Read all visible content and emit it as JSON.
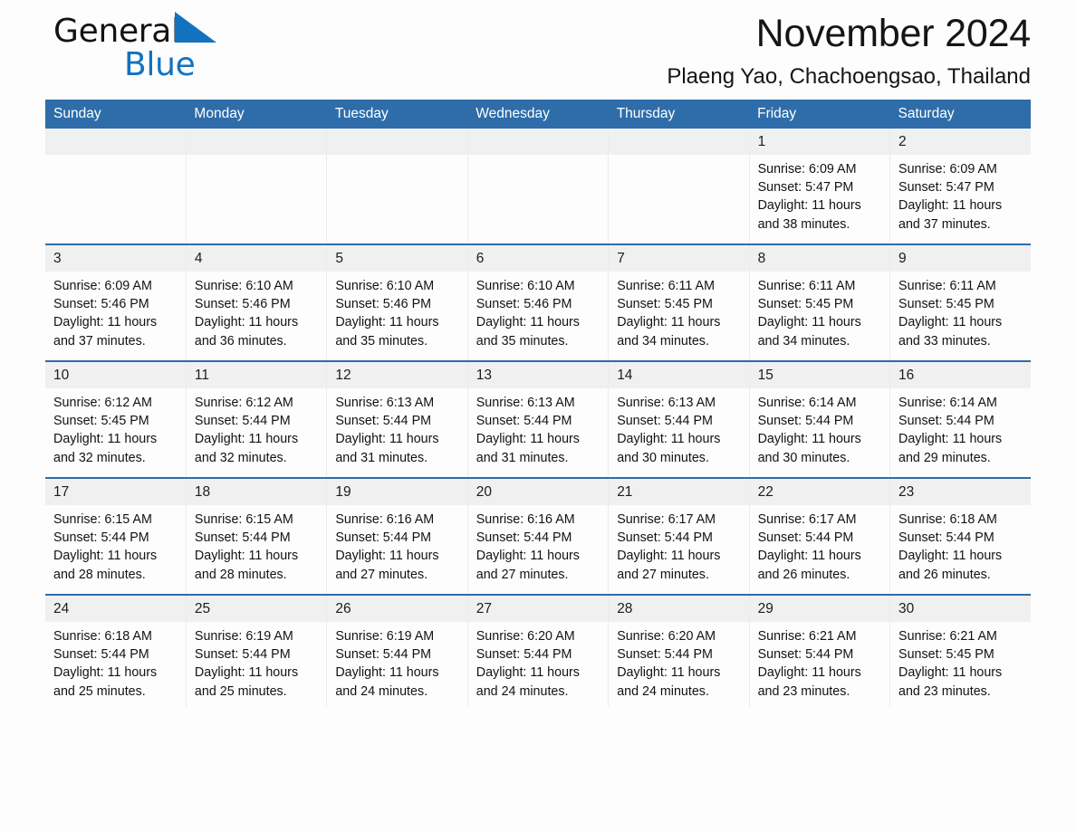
{
  "brand": {
    "name_part1": "General",
    "name_part2": "Blue",
    "logo_icon": "triangle-flag-icon",
    "accent_color": "#1272c0"
  },
  "header": {
    "month_title": "November 2024",
    "location": "Plaeng Yao, Chachoengsao, Thailand"
  },
  "theme": {
    "header_blue": "#2e6da9",
    "daynum_band": "#f0f0f0",
    "page_background": "#fdfdfd"
  },
  "calendar": {
    "weekday_headers": [
      "Sunday",
      "Monday",
      "Tuesday",
      "Wednesday",
      "Thursday",
      "Friday",
      "Saturday"
    ],
    "weeks": [
      [
        {
          "day": "",
          "sunrise": "",
          "sunset": "",
          "daylight_line1": "",
          "daylight_line2": ""
        },
        {
          "day": "",
          "sunrise": "",
          "sunset": "",
          "daylight_line1": "",
          "daylight_line2": ""
        },
        {
          "day": "",
          "sunrise": "",
          "sunset": "",
          "daylight_line1": "",
          "daylight_line2": ""
        },
        {
          "day": "",
          "sunrise": "",
          "sunset": "",
          "daylight_line1": "",
          "daylight_line2": ""
        },
        {
          "day": "",
          "sunrise": "",
          "sunset": "",
          "daylight_line1": "",
          "daylight_line2": ""
        },
        {
          "day": "1",
          "sunrise": "Sunrise: 6:09 AM",
          "sunset": "Sunset: 5:47 PM",
          "daylight_line1": "Daylight: 11 hours",
          "daylight_line2": "and 38 minutes."
        },
        {
          "day": "2",
          "sunrise": "Sunrise: 6:09 AM",
          "sunset": "Sunset: 5:47 PM",
          "daylight_line1": "Daylight: 11 hours",
          "daylight_line2": "and 37 minutes."
        }
      ],
      [
        {
          "day": "3",
          "sunrise": "Sunrise: 6:09 AM",
          "sunset": "Sunset: 5:46 PM",
          "daylight_line1": "Daylight: 11 hours",
          "daylight_line2": "and 37 minutes."
        },
        {
          "day": "4",
          "sunrise": "Sunrise: 6:10 AM",
          "sunset": "Sunset: 5:46 PM",
          "daylight_line1": "Daylight: 11 hours",
          "daylight_line2": "and 36 minutes."
        },
        {
          "day": "5",
          "sunrise": "Sunrise: 6:10 AM",
          "sunset": "Sunset: 5:46 PM",
          "daylight_line1": "Daylight: 11 hours",
          "daylight_line2": "and 35 minutes."
        },
        {
          "day": "6",
          "sunrise": "Sunrise: 6:10 AM",
          "sunset": "Sunset: 5:46 PM",
          "daylight_line1": "Daylight: 11 hours",
          "daylight_line2": "and 35 minutes."
        },
        {
          "day": "7",
          "sunrise": "Sunrise: 6:11 AM",
          "sunset": "Sunset: 5:45 PM",
          "daylight_line1": "Daylight: 11 hours",
          "daylight_line2": "and 34 minutes."
        },
        {
          "day": "8",
          "sunrise": "Sunrise: 6:11 AM",
          "sunset": "Sunset: 5:45 PM",
          "daylight_line1": "Daylight: 11 hours",
          "daylight_line2": "and 34 minutes."
        },
        {
          "day": "9",
          "sunrise": "Sunrise: 6:11 AM",
          "sunset": "Sunset: 5:45 PM",
          "daylight_line1": "Daylight: 11 hours",
          "daylight_line2": "and 33 minutes."
        }
      ],
      [
        {
          "day": "10",
          "sunrise": "Sunrise: 6:12 AM",
          "sunset": "Sunset: 5:45 PM",
          "daylight_line1": "Daylight: 11 hours",
          "daylight_line2": "and 32 minutes."
        },
        {
          "day": "11",
          "sunrise": "Sunrise: 6:12 AM",
          "sunset": "Sunset: 5:44 PM",
          "daylight_line1": "Daylight: 11 hours",
          "daylight_line2": "and 32 minutes."
        },
        {
          "day": "12",
          "sunrise": "Sunrise: 6:13 AM",
          "sunset": "Sunset: 5:44 PM",
          "daylight_line1": "Daylight: 11 hours",
          "daylight_line2": "and 31 minutes."
        },
        {
          "day": "13",
          "sunrise": "Sunrise: 6:13 AM",
          "sunset": "Sunset: 5:44 PM",
          "daylight_line1": "Daylight: 11 hours",
          "daylight_line2": "and 31 minutes."
        },
        {
          "day": "14",
          "sunrise": "Sunrise: 6:13 AM",
          "sunset": "Sunset: 5:44 PM",
          "daylight_line1": "Daylight: 11 hours",
          "daylight_line2": "and 30 minutes."
        },
        {
          "day": "15",
          "sunrise": "Sunrise: 6:14 AM",
          "sunset": "Sunset: 5:44 PM",
          "daylight_line1": "Daylight: 11 hours",
          "daylight_line2": "and 30 minutes."
        },
        {
          "day": "16",
          "sunrise": "Sunrise: 6:14 AM",
          "sunset": "Sunset: 5:44 PM",
          "daylight_line1": "Daylight: 11 hours",
          "daylight_line2": "and 29 minutes."
        }
      ],
      [
        {
          "day": "17",
          "sunrise": "Sunrise: 6:15 AM",
          "sunset": "Sunset: 5:44 PM",
          "daylight_line1": "Daylight: 11 hours",
          "daylight_line2": "and 28 minutes."
        },
        {
          "day": "18",
          "sunrise": "Sunrise: 6:15 AM",
          "sunset": "Sunset: 5:44 PM",
          "daylight_line1": "Daylight: 11 hours",
          "daylight_line2": "and 28 minutes."
        },
        {
          "day": "19",
          "sunrise": "Sunrise: 6:16 AM",
          "sunset": "Sunset: 5:44 PM",
          "daylight_line1": "Daylight: 11 hours",
          "daylight_line2": "and 27 minutes."
        },
        {
          "day": "20",
          "sunrise": "Sunrise: 6:16 AM",
          "sunset": "Sunset: 5:44 PM",
          "daylight_line1": "Daylight: 11 hours",
          "daylight_line2": "and 27 minutes."
        },
        {
          "day": "21",
          "sunrise": "Sunrise: 6:17 AM",
          "sunset": "Sunset: 5:44 PM",
          "daylight_line1": "Daylight: 11 hours",
          "daylight_line2": "and 27 minutes."
        },
        {
          "day": "22",
          "sunrise": "Sunrise: 6:17 AM",
          "sunset": "Sunset: 5:44 PM",
          "daylight_line1": "Daylight: 11 hours",
          "daylight_line2": "and 26 minutes."
        },
        {
          "day": "23",
          "sunrise": "Sunrise: 6:18 AM",
          "sunset": "Sunset: 5:44 PM",
          "daylight_line1": "Daylight: 11 hours",
          "daylight_line2": "and 26 minutes."
        }
      ],
      [
        {
          "day": "24",
          "sunrise": "Sunrise: 6:18 AM",
          "sunset": "Sunset: 5:44 PM",
          "daylight_line1": "Daylight: 11 hours",
          "daylight_line2": "and 25 minutes."
        },
        {
          "day": "25",
          "sunrise": "Sunrise: 6:19 AM",
          "sunset": "Sunset: 5:44 PM",
          "daylight_line1": "Daylight: 11 hours",
          "daylight_line2": "and 25 minutes."
        },
        {
          "day": "26",
          "sunrise": "Sunrise: 6:19 AM",
          "sunset": "Sunset: 5:44 PM",
          "daylight_line1": "Daylight: 11 hours",
          "daylight_line2": "and 24 minutes."
        },
        {
          "day": "27",
          "sunrise": "Sunrise: 6:20 AM",
          "sunset": "Sunset: 5:44 PM",
          "daylight_line1": "Daylight: 11 hours",
          "daylight_line2": "and 24 minutes."
        },
        {
          "day": "28",
          "sunrise": "Sunrise: 6:20 AM",
          "sunset": "Sunset: 5:44 PM",
          "daylight_line1": "Daylight: 11 hours",
          "daylight_line2": "and 24 minutes."
        },
        {
          "day": "29",
          "sunrise": "Sunrise: 6:21 AM",
          "sunset": "Sunset: 5:44 PM",
          "daylight_line1": "Daylight: 11 hours",
          "daylight_line2": "and 23 minutes."
        },
        {
          "day": "30",
          "sunrise": "Sunrise: 6:21 AM",
          "sunset": "Sunset: 5:45 PM",
          "daylight_line1": "Daylight: 11 hours",
          "daylight_line2": "and 23 minutes."
        }
      ]
    ]
  }
}
